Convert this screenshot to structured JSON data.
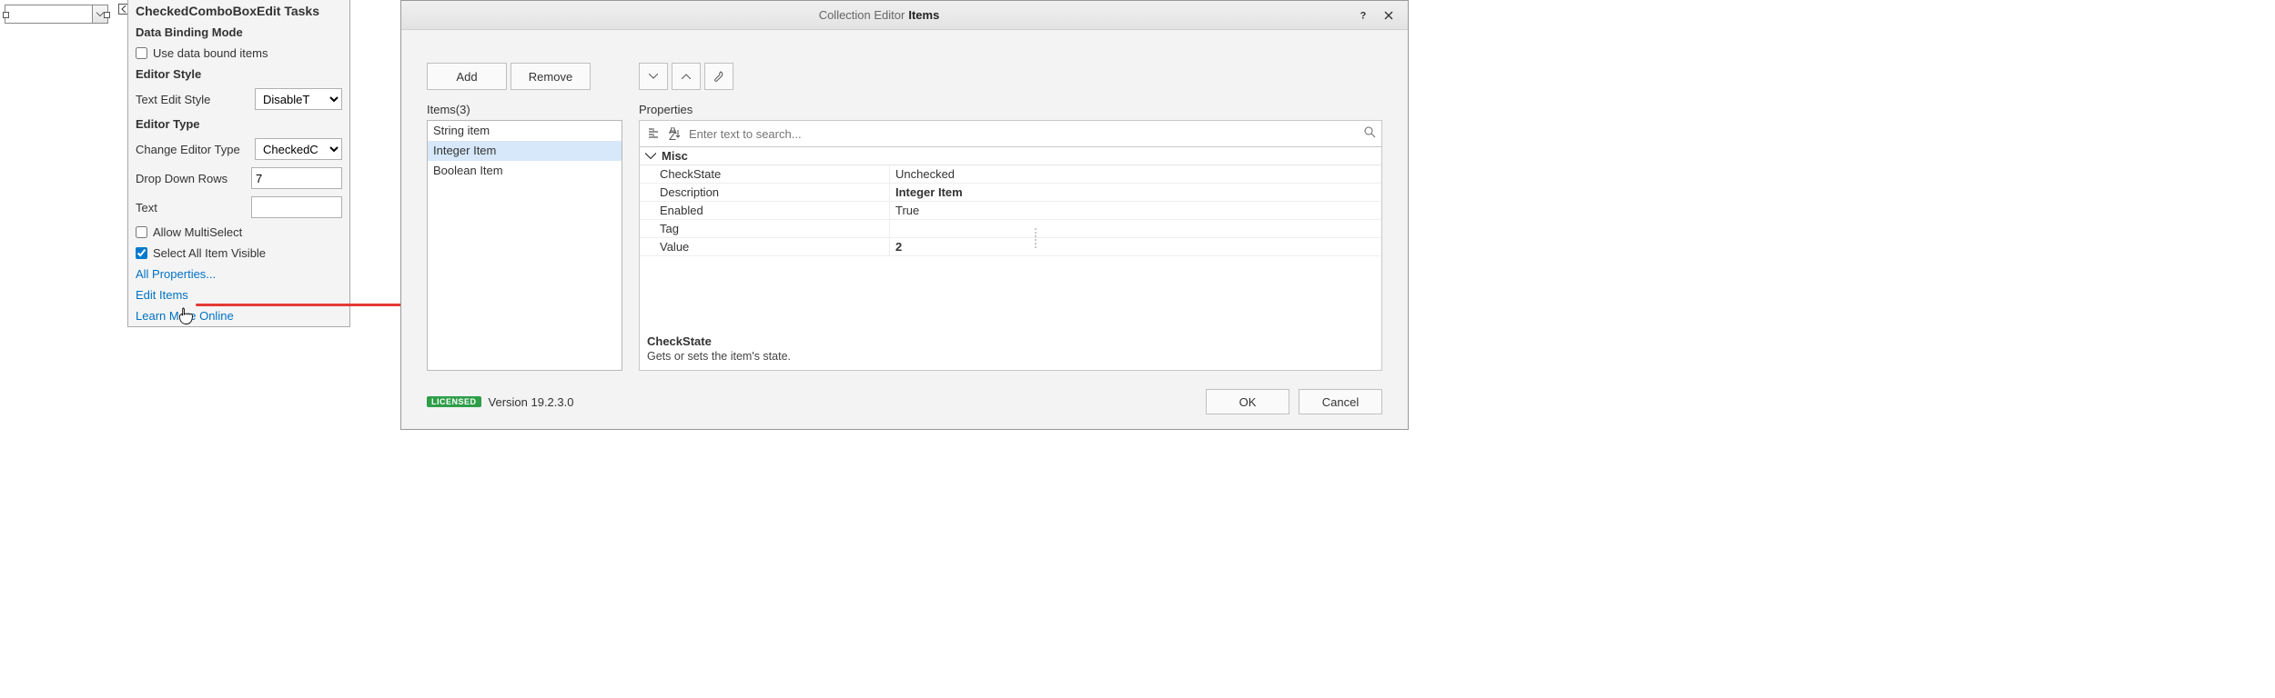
{
  "control": {
    "placeholder": ""
  },
  "tasks": {
    "title": "CheckedComboBoxEdit Tasks",
    "section_binding": "Data Binding Mode",
    "use_data_bound": "Use data bound items",
    "use_data_bound_checked": false,
    "section_style": "Editor Style",
    "text_edit_style_label": "Text Edit Style",
    "text_edit_style_value": "DisableT",
    "section_type": "Editor Type",
    "change_editor_type_label": "Change Editor Type",
    "change_editor_type_value": "CheckedC",
    "drop_down_rows_label": "Drop Down Rows",
    "drop_down_rows_value": "7",
    "text_label": "Text",
    "text_value": "",
    "allow_multiselect": "Allow MultiSelect",
    "allow_multiselect_checked": false,
    "select_all_visible": "Select All Item Visible",
    "select_all_visible_checked": true,
    "link_all_properties": "All Properties...",
    "link_edit_items": "Edit Items",
    "link_learn_more": "Learn More Online"
  },
  "dialog": {
    "title_prefix": "Collection Editor",
    "title_subject": "Items",
    "toolbar": {
      "add": "Add",
      "remove": "Remove"
    },
    "items_label": "Items(3)",
    "items": [
      {
        "label": "String item",
        "selected": false
      },
      {
        "label": "Integer Item",
        "selected": true
      },
      {
        "label": "Boolean Item",
        "selected": false
      }
    ],
    "properties_label": "Properties",
    "search_placeholder": "Enter text to search...",
    "category": "Misc",
    "props": [
      {
        "name": "CheckState",
        "value": "Unchecked",
        "bold": false
      },
      {
        "name": "Description",
        "value": "Integer Item",
        "bold": true
      },
      {
        "name": "Enabled",
        "value": "True",
        "bold": false
      },
      {
        "name": "Tag",
        "value": "",
        "bold": false
      },
      {
        "name": "Value",
        "value": "2",
        "bold": true
      }
    ],
    "desc_title": "CheckState",
    "desc_body": "Gets or sets the item's state.",
    "license_badge": "LICENSED",
    "version": "Version 19.2.3.0",
    "ok": "OK",
    "cancel": "Cancel"
  }
}
